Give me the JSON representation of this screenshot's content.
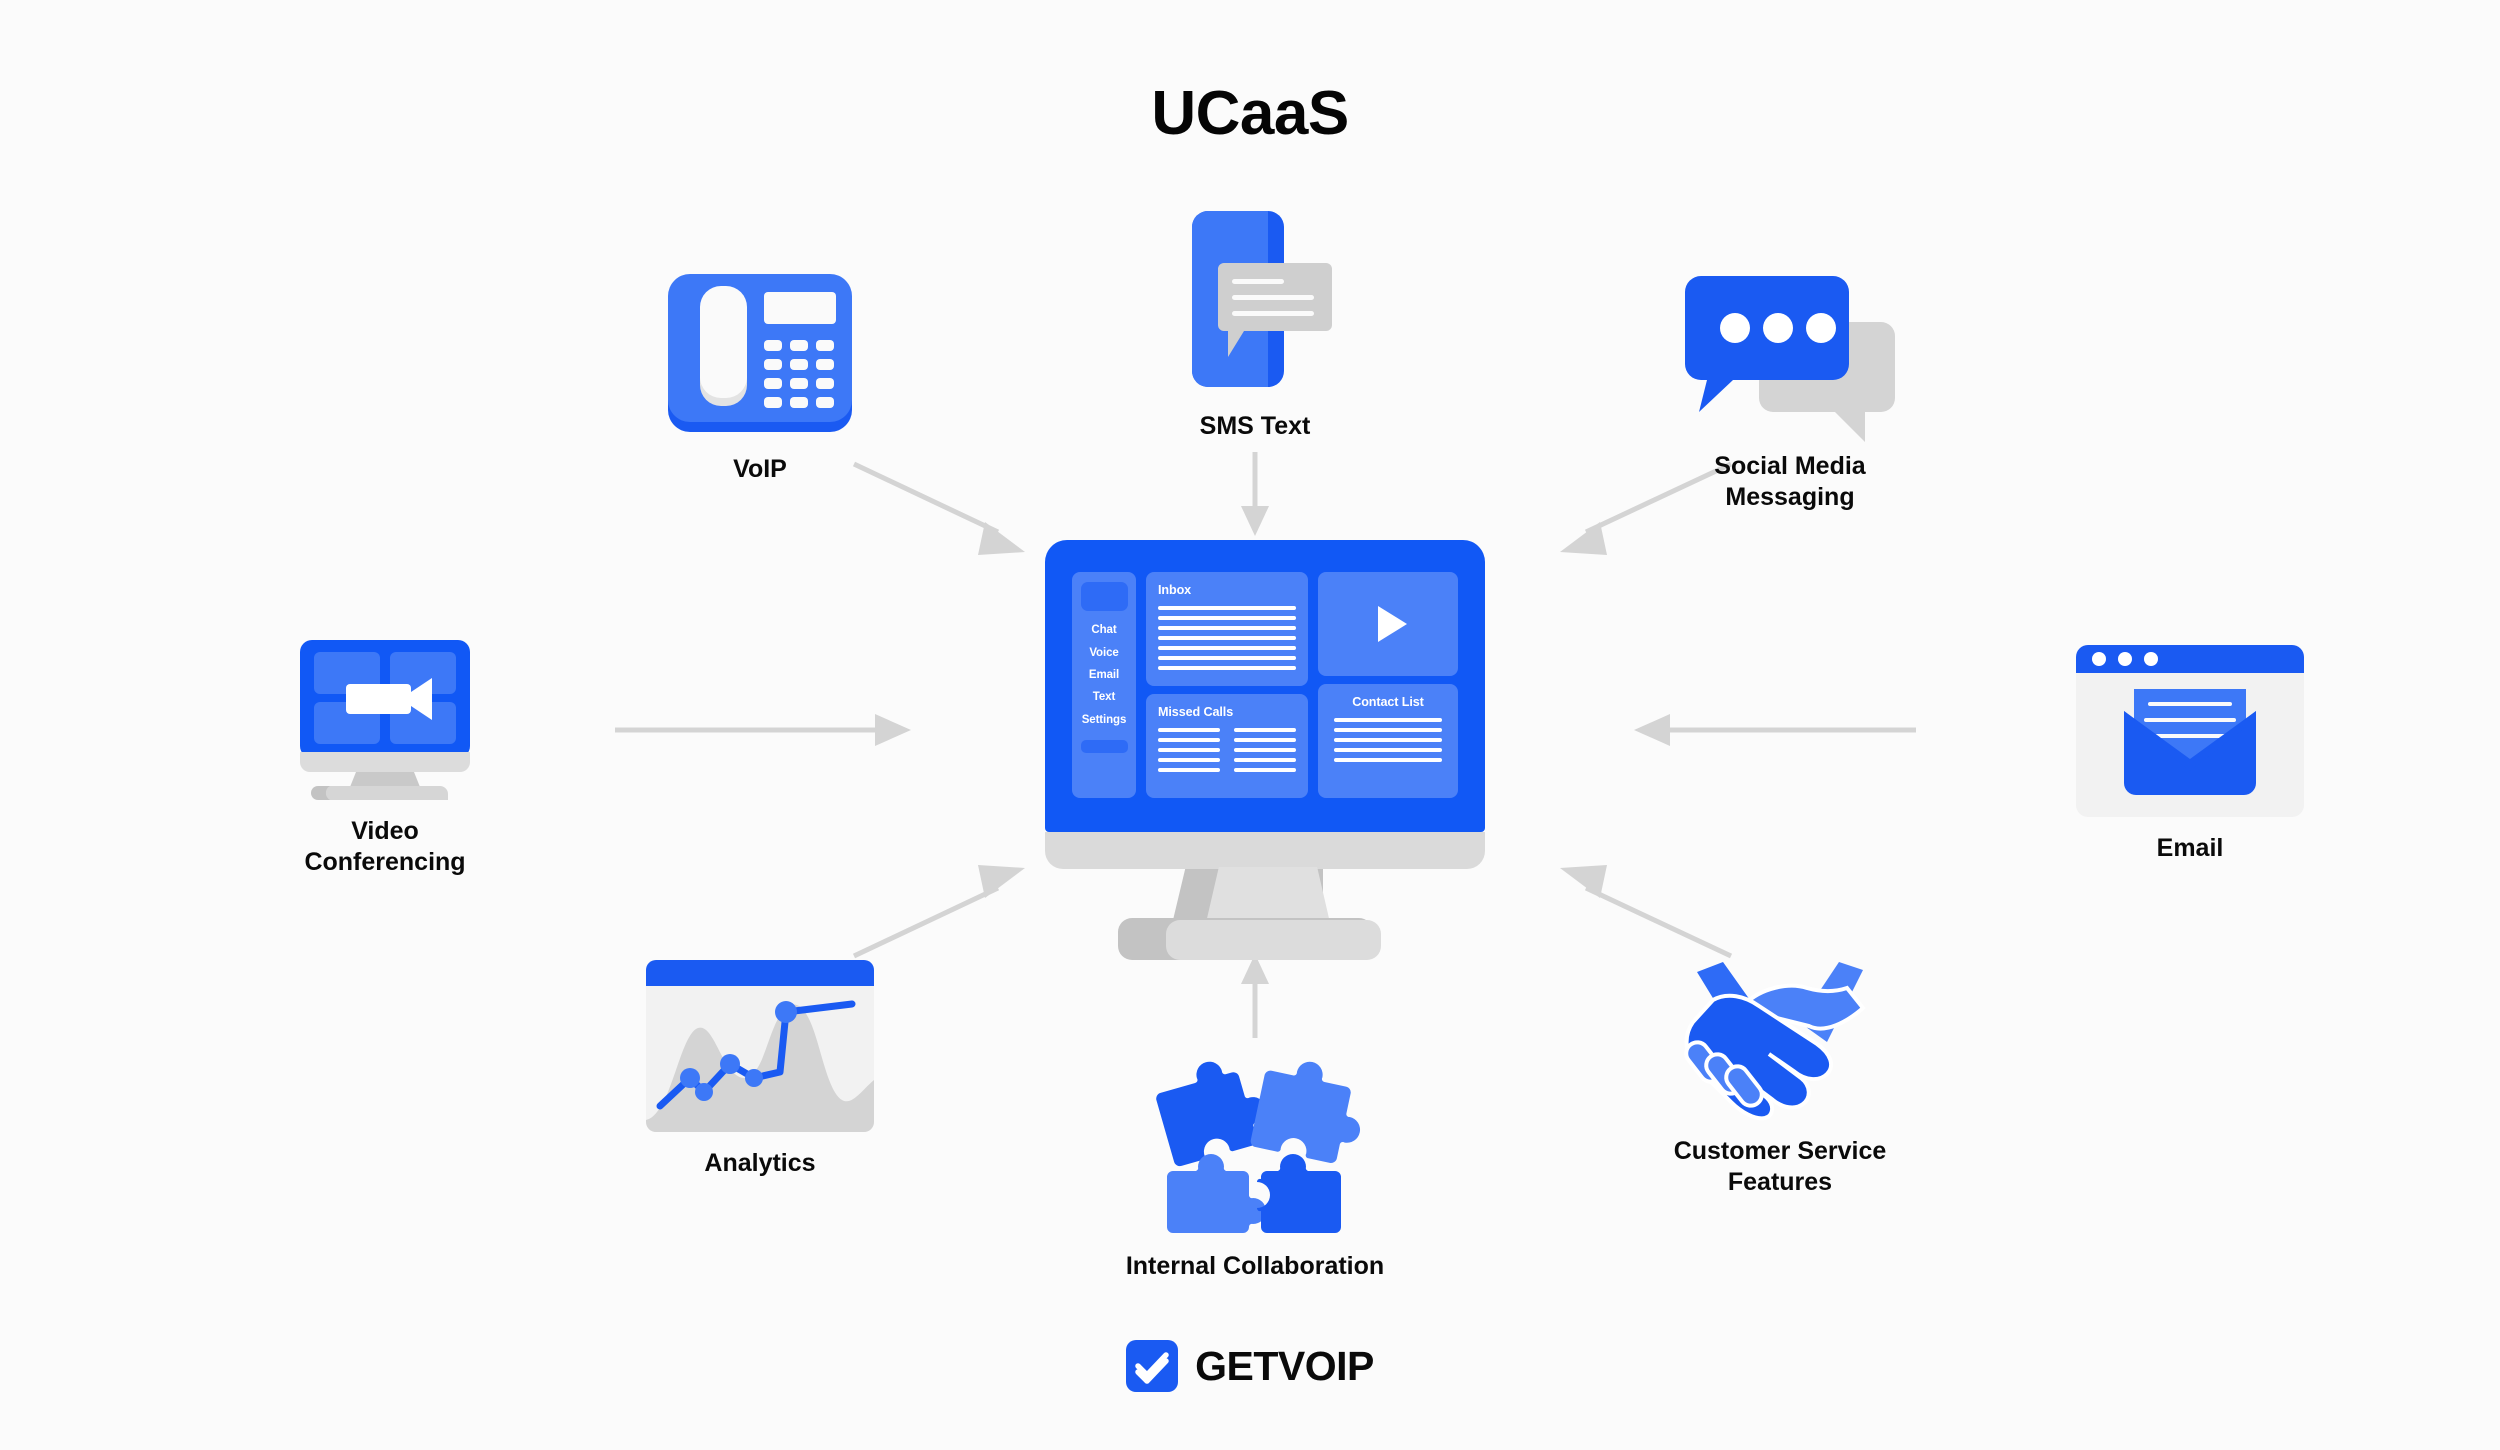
{
  "page": {
    "title": "UCaaS",
    "background_color": "#fbfbfb",
    "accent_blue": "#1a5af2",
    "light_blue": "#4b81f8",
    "gray": "#d4d4d4"
  },
  "nodes": [
    {
      "id": "voip",
      "label": "VoIP",
      "icon": "desk-phone-icon"
    },
    {
      "id": "sms",
      "label": "SMS Text",
      "icon": "phone-message-icon"
    },
    {
      "id": "social",
      "label": "Social Media\nMessaging",
      "icon": "chat-bubbles-icon"
    },
    {
      "id": "email",
      "label": "Email",
      "icon": "email-window-icon"
    },
    {
      "id": "support",
      "label": "Customer Service\nFeatures",
      "icon": "handshake-icon"
    },
    {
      "id": "collab",
      "label": "Internal Collaboration",
      "icon": "puzzle-pieces-icon"
    },
    {
      "id": "analytics",
      "label": "Analytics",
      "icon": "analytics-chart-icon"
    },
    {
      "id": "video",
      "label": "Video\nConferencing",
      "icon": "video-monitor-icon"
    }
  ],
  "central": {
    "name": "ucaas-dashboard-monitor",
    "sidebar": {
      "items": [
        "Chat",
        "Voice",
        "Email",
        "Text",
        "Settings"
      ]
    },
    "panels": {
      "inbox_title": "Inbox",
      "inbox_line_count": 7,
      "missed_calls_title": "Missed Calls",
      "missed_calls_line_count": 5,
      "contact_list_title": "Contact List",
      "contact_list_line_count": 5,
      "video_player_icon": "play-icon"
    }
  },
  "arrows": [
    {
      "from": "voip",
      "to": "central",
      "direction": "down-right"
    },
    {
      "from": "sms",
      "to": "central",
      "direction": "down"
    },
    {
      "from": "social",
      "to": "central",
      "direction": "down-left"
    },
    {
      "from": "email",
      "to": "central",
      "direction": "left"
    },
    {
      "from": "support",
      "to": "central",
      "direction": "up-left"
    },
    {
      "from": "collab",
      "to": "central",
      "direction": "up"
    },
    {
      "from": "analytics",
      "to": "central",
      "direction": "up-right"
    },
    {
      "from": "video",
      "to": "central",
      "direction": "right"
    }
  ],
  "brand": {
    "name": "GETVOIP",
    "mark_icon": "double-check-icon"
  }
}
